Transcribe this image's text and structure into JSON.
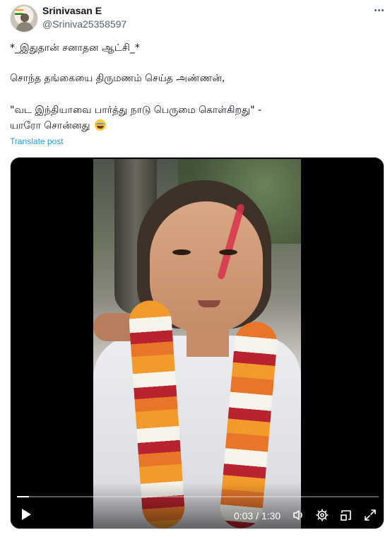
{
  "post": {
    "author_name": "Srinivasan E",
    "author_handle": "@Sriniva25358597",
    "lines": [
      "*_இதுதான் சனாதன ஆட்சி_*",
      "சொந்த தங்கையை திருமணம் செய்த அண்ணன்,",
      "\"வட இந்தியாவை பார்த்து நாடு பெருமை கொள்கிறது\" -",
      "யாரோ சொன்னது"
    ],
    "translate_label": "Translate post"
  },
  "video": {
    "time_display": "0:03 / 1:30",
    "progress": 0.033
  },
  "colors": {
    "link": "#1d9bf0",
    "secondary_text": "#536471",
    "primary_text": "#0f1419"
  }
}
